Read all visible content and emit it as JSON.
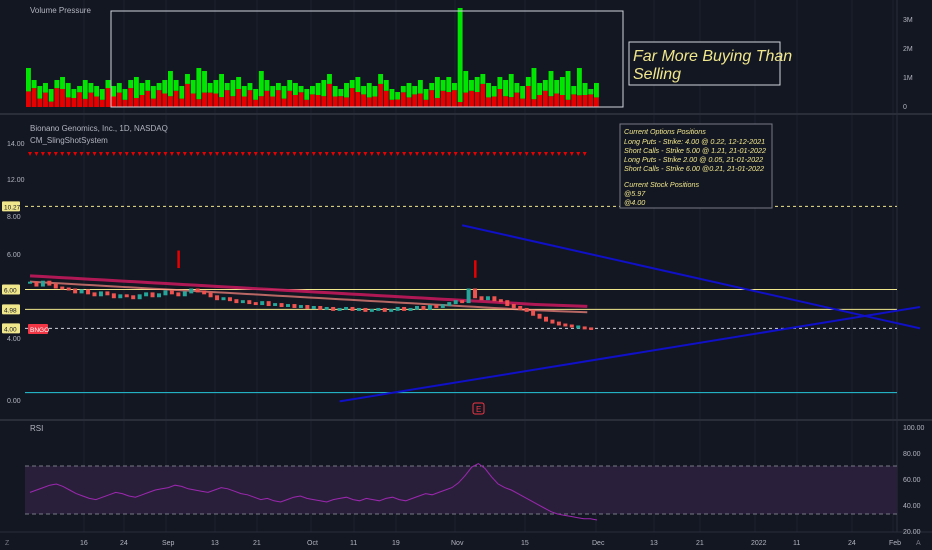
{
  "volume_pane": {
    "title": "Volume Pressure",
    "axis_ticks": [
      "3M",
      "2M",
      "1M",
      "0"
    ],
    "annotation": [
      "Far More Buying Than",
      "Selling"
    ]
  },
  "price_pane": {
    "symbol_line": "Bionano Genomics, Inc., 1D, NASDAQ",
    "indicator": "CM_SlingShotSystem",
    "axis_ticks": [
      "14.00",
      "12.00",
      "8.00",
      "6.00",
      "4.00",
      "0.00"
    ],
    "price_tags": [
      {
        "text": "10.27",
        "value": 10.27,
        "color": "#f0e68c"
      },
      {
        "text": "6.00",
        "value": 6.0,
        "color": "#f0e68c"
      },
      {
        "text": "4.98",
        "value": 4.98,
        "color": "#f0e68c"
      },
      {
        "text": "4.00",
        "value": 4.0,
        "color": "#f0e68c"
      },
      {
        "text": "BNGO",
        "value": 3.97,
        "color": "#f23645"
      }
    ],
    "options_box": {
      "title": "Current Options Positions",
      "lines": [
        "Long Puts - Strike: 4.00 @ 0.22, 12-12-2021",
        "Short Calls - Strike 5.00 @ 1.21, 21-01-2022",
        "Long Puts - Strike 2.00 @ 0.05, 21-01-2022",
        "Short Calls - Strike 6.00 @0.21, 21-01-2022"
      ],
      "stock_title": "Current Stock Positions",
      "stock_lines": [
        "@5.97",
        "@4.00"
      ]
    },
    "earnings_marker": "E"
  },
  "rsi_pane": {
    "title": "RSI",
    "axis_ticks": [
      "100.00",
      "80.00",
      "60.00",
      "40.00",
      "20.00"
    ]
  },
  "time_axis": [
    "16",
    "24",
    "Sep",
    "13",
    "21",
    "Oct",
    "11",
    "19",
    "Nov",
    "15",
    "Dec",
    "13",
    "21",
    "2022",
    "11",
    "24",
    "Feb"
  ],
  "colors": {
    "background": "#131722",
    "up": "#00e600",
    "down": "#e60000",
    "ema_band": "#c2185b",
    "trendline": "#1010c8",
    "rsi_line": "#9c27b0",
    "rsi_band": "#2a1f3a",
    "horizontal_lines": "#f0e68c",
    "cyan_line": "#26c6da"
  },
  "chart_data": [
    {
      "type": "bar",
      "title": "Volume Pressure",
      "y_unit": "shares (M)",
      "ylim": [
        0,
        3.2
      ],
      "values": [
        1.3,
        0.9,
        0.7,
        0.8,
        0.6,
        0.9,
        1.0,
        0.8,
        0.6,
        0.7,
        0.9,
        0.8,
        0.7,
        0.6,
        0.9,
        0.7,
        0.8,
        0.6,
        0.9,
        1.0,
        0.8,
        0.9,
        0.7,
        0.8,
        0.9,
        1.2,
        0.9,
        0.7,
        1.1,
        0.9,
        1.3,
        1.2,
        0.8,
        0.9,
        1.1,
        0.8,
        0.9,
        1.0,
        0.7,
        0.8,
        0.6,
        1.2,
        0.9,
        0.7,
        0.8,
        0.7,
        0.9,
        0.8,
        0.7,
        0.6,
        0.7,
        0.8,
        0.9,
        1.1,
        0.7,
        0.6,
        0.8,
        0.9,
        1.0,
        0.7,
        0.8,
        0.7,
        1.1,
        0.9,
        0.6,
        0.5,
        0.7,
        0.8,
        0.7,
        0.9,
        0.6,
        0.8,
        1.0,
        0.9,
        1.0,
        0.8,
        3.3,
        1.2,
        0.9,
        1.0,
        1.1,
        0.8,
        0.7,
        1.0,
        0.9,
        1.1,
        0.8,
        0.7,
        1.0,
        1.3,
        0.8,
        0.9,
        1.2,
        0.9,
        1.0,
        1.2,
        0.7,
        1.3,
        0.8,
        0.6,
        0.8
      ],
      "buy_fraction": [
        0.6,
        0.3,
        0.6,
        0.4,
        0.7,
        0.3,
        0.4,
        0.6,
        0.5,
        0.3,
        0.7,
        0.4,
        0.5,
        0.6,
        0.3,
        0.5,
        0.4,
        0.6,
        0.3,
        0.7,
        0.5,
        0.4,
        0.6,
        0.3,
        0.5,
        0.7,
        0.4,
        0.6,
        0.3,
        0.5,
        0.8,
        0.6,
        0.4,
        0.5,
        0.7,
        0.3,
        0.6,
        0.4,
        0.5,
        0.3,
        0.6,
        0.7,
        0.4,
        0.5,
        0.3,
        0.6,
        0.4,
        0.5,
        0.3,
        0.6,
        0.4,
        0.5,
        0.6,
        0.3,
        0.5,
        0.4,
        0.6,
        0.3,
        0.5,
        0.4,
        0.6,
        0.5,
        0.3,
        0.4,
        0.6,
        0.5,
        0.3,
        0.6,
        0.4,
        0.5,
        0.6,
        0.3,
        0.7,
        0.4,
        0.5,
        0.3,
        0.95,
        0.6,
        0.4,
        0.5,
        0.3,
        0.6,
        0.5,
        0.4,
        0.6,
        0.7,
        0.4,
        0.6,
        0.3,
        0.8,
        0.5,
        0.4,
        0.7,
        0.5,
        0.6,
        0.8,
        0.4,
        0.7,
        0.5,
        0.3,
        0.6
      ]
    },
    {
      "type": "candlestick",
      "title": "Bionano Genomics, Inc., 1D, NASDAQ",
      "ylim": [
        -0.5,
        14.5
      ],
      "close": [
        6.35,
        6.2,
        6.4,
        6.25,
        6.1,
        6.05,
        6.0,
        5.85,
        5.95,
        5.8,
        5.7,
        5.85,
        5.75,
        5.6,
        5.7,
        5.65,
        5.55,
        5.7,
        5.8,
        5.65,
        5.75,
        5.9,
        5.8,
        5.7,
        5.85,
        6.0,
        5.9,
        5.8,
        5.65,
        5.5,
        5.55,
        5.45,
        5.35,
        5.4,
        5.3,
        5.25,
        5.35,
        5.2,
        5.25,
        5.15,
        5.2,
        5.1,
        5.15,
        5.05,
        5.1,
        5.0,
        5.05,
        4.95,
        5.0,
        5.05,
        4.95,
        5.0,
        4.9,
        4.95,
        5.0,
        4.9,
        4.95,
        5.05,
        4.95,
        5.0,
        5.1,
        5.0,
        5.15,
        5.1,
        5.2,
        5.3,
        5.4,
        5.35,
        6.0,
        5.6,
        5.5,
        5.6,
        5.45,
        5.4,
        5.2,
        5.1,
        5.0,
        4.9,
        4.7,
        4.55,
        4.4,
        4.3,
        4.2,
        4.15,
        4.1,
        4.05,
        4.0,
        3.97
      ],
      "up_days": [
        0,
        2,
        8,
        11,
        14,
        17,
        18,
        20,
        21,
        24,
        25,
        30,
        33,
        36,
        38,
        40,
        42,
        44,
        46,
        48,
        49,
        51,
        53,
        54,
        56,
        57,
        59,
        60,
        62,
        64,
        65,
        66,
        68,
        71,
        85
      ],
      "sling_ema": [
        6.55,
        6.52,
        6.49,
        6.46,
        6.43,
        6.4,
        6.37,
        6.34,
        6.31,
        6.28,
        6.25,
        6.22,
        6.19,
        6.16,
        6.13,
        6.1,
        6.07,
        6.04,
        6.01,
        5.98,
        5.95,
        5.92,
        5.89,
        5.86,
        5.83,
        5.8,
        5.77,
        5.74,
        5.71,
        5.68,
        5.65,
        5.62,
        5.59,
        5.56,
        5.53,
        5.5,
        5.47,
        5.44,
        5.41,
        5.38,
        5.35,
        5.32,
        5.29,
        5.26,
        5.23,
        5.2,
        5.17,
        5.14,
        5.11,
        5.08,
        5.06,
        5.04,
        5.02,
        5.0,
        4.98
      ],
      "signals": [
        {
          "bar": 23,
          "price": 7.1
        },
        {
          "bar": 69,
          "price": 6.6
        }
      ],
      "levels": [
        10.27,
        6.0,
        4.98,
        4.0,
        0.7
      ],
      "trendlines": [
        {
          "from": {
            "bar": 67,
            "price": 9.3
          },
          "to": {
            "bar": 138,
            "price": 4.0
          }
        },
        {
          "from": {
            "bar": 48,
            "price": 0.25
          },
          "to": {
            "bar": 138,
            "price": 5.1
          }
        }
      ]
    },
    {
      "type": "line",
      "title": "RSI",
      "ylim": [
        15,
        105
      ],
      "band": [
        30,
        70
      ],
      "values": [
        48,
        50,
        52,
        54,
        55,
        53,
        50,
        47,
        45,
        43,
        42,
        44,
        46,
        48,
        47,
        45,
        44,
        46,
        48,
        50,
        51,
        52,
        54,
        53,
        51,
        50,
        49,
        48,
        50,
        52,
        51,
        49,
        47,
        46,
        44,
        42,
        43,
        41,
        40,
        42,
        44,
        45,
        43,
        42,
        41,
        40,
        42,
        43,
        44,
        42,
        41,
        43,
        42,
        41,
        43,
        44,
        42,
        41,
        43,
        45,
        47,
        46,
        48,
        50,
        52,
        56,
        62,
        69,
        72,
        68,
        61,
        55,
        52,
        50,
        47,
        44,
        41,
        38,
        35,
        32,
        30,
        29,
        28,
        27,
        26,
        26,
        25
      ]
    }
  ]
}
